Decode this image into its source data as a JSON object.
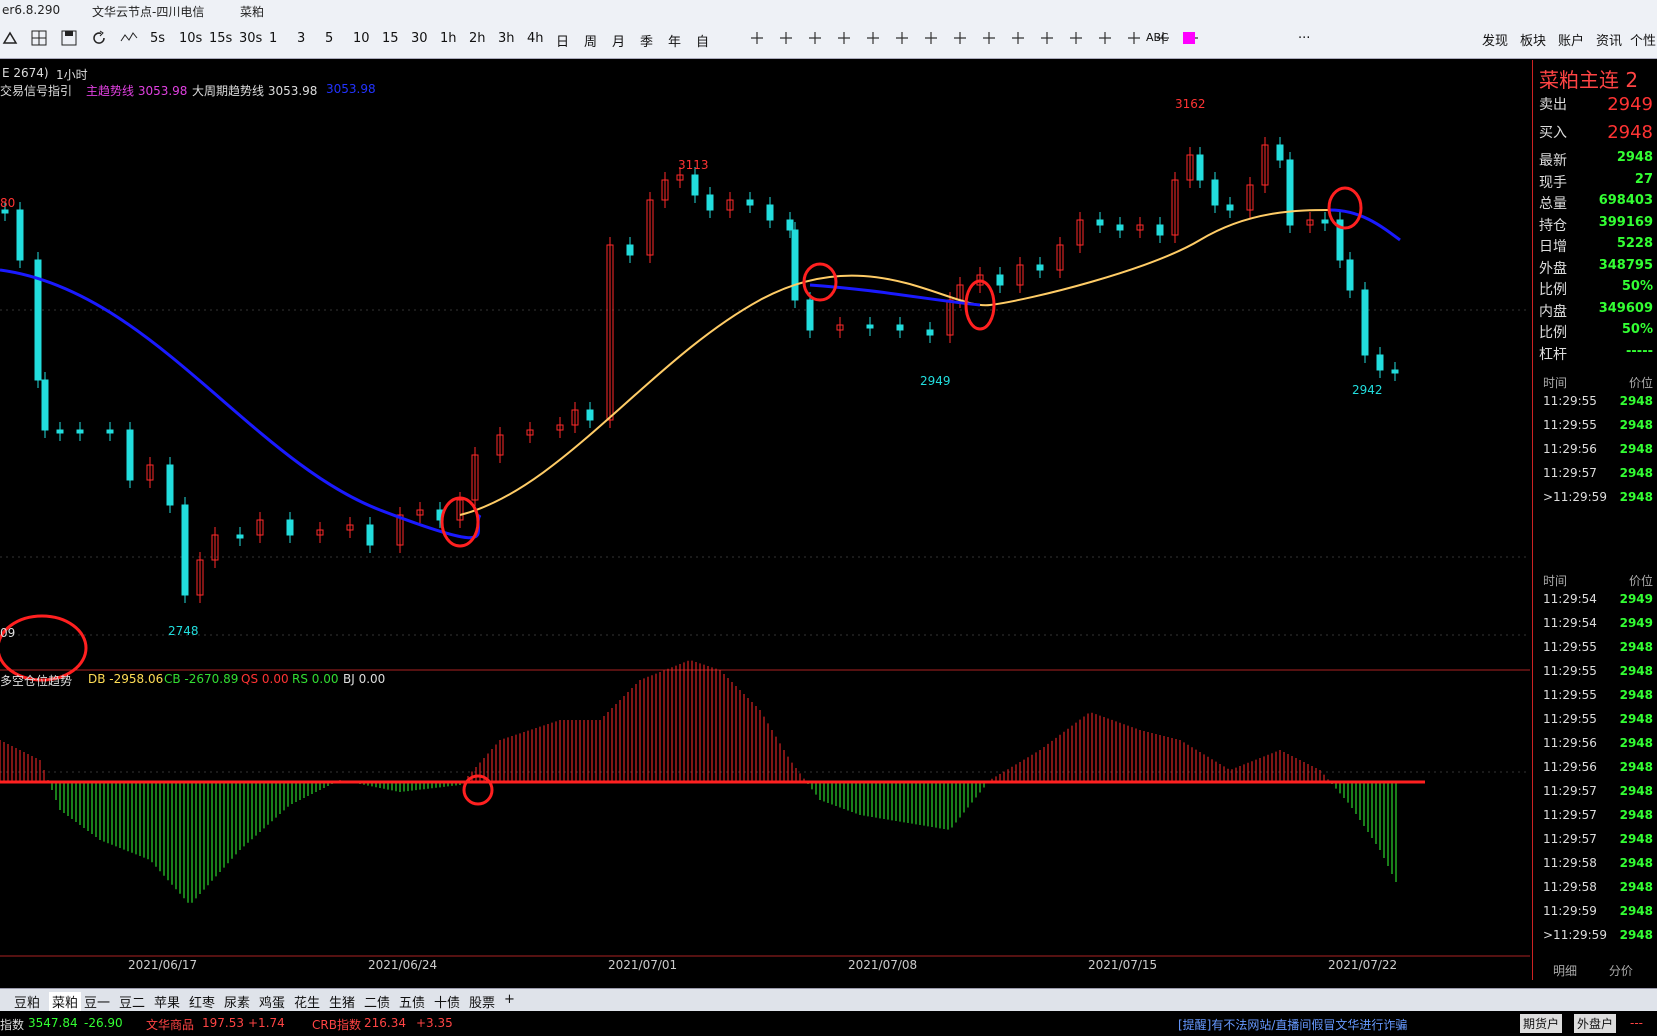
{
  "titlebar": {
    "version": "er6.8.290",
    "server": "文华云节点-四川电信",
    "symbol": "菜粕"
  },
  "toolbar": {
    "periods": [
      "5s",
      "10s",
      "15s",
      "30s",
      "1",
      "3",
      "5",
      "10",
      "15",
      "30",
      "1h",
      "2h",
      "3h",
      "4h",
      "日",
      "周",
      "月",
      "季",
      "年",
      "自"
    ],
    "abc_label": "ABC",
    "more": "···",
    "right_menu": [
      "发现",
      "板块",
      "账户",
      "资讯",
      "个性"
    ]
  },
  "chart": {
    "contract_tag": "E 2674)",
    "period": "1小时",
    "indicator_name": "交易信号指引",
    "main_trend_label": "主趋势线 3053.98",
    "big_trend_label": "大周期趋势线 3053.98",
    "blue_value": "3053.98",
    "price_labels": {
      "high_left": "3113",
      "high_right": "3162",
      "low_mid": "2949",
      "low_left": "2748",
      "low_last": "2942",
      "left_edge_top": "80",
      "left_edge_bottom": "09"
    },
    "sub_indicator_name": "多空仓位趋势",
    "db_label": "DB -2958.06",
    "cb_label": "CB -2670.89",
    "qs_label": "QS 0.00",
    "rs_label": "RS 0.00",
    "bj_label": "BJ 0.00",
    "dates": [
      "2021/06/17",
      "2021/06/24",
      "2021/07/01",
      "2021/07/08",
      "2021/07/15",
      "2021/07/22"
    ],
    "colors": {
      "up": "#ff2a2a",
      "down": "#22dddd",
      "flat": "#ffffff",
      "trend_blue": "#1a1aff",
      "trend_yellow": "#ffcc66",
      "hist_red": "#ff2a2a",
      "hist_green": "#33ff33"
    }
  },
  "side": {
    "title": "菜粕主连 2",
    "sell_label": "卖出",
    "sell_value": "2949",
    "buy_label": "买入",
    "buy_value": "2948",
    "stats": [
      {
        "k": "最新",
        "v": "2948"
      },
      {
        "k": "现手",
        "v": "27"
      },
      {
        "k": "总量",
        "v": "698403"
      },
      {
        "k": "持仓",
        "v": "399169"
      },
      {
        "k": "日增",
        "v": "5228"
      },
      {
        "k": "外盘",
        "v": "348795"
      },
      {
        "k": "比例",
        "v": "50%"
      },
      {
        "k": "内盘",
        "v": "349609"
      },
      {
        "k": "比例",
        "v": "50%"
      },
      {
        "k": "杠杆",
        "v": "-----"
      }
    ],
    "col_time": "时间",
    "col_price": "价位",
    "ticks1": [
      {
        "t": "11:29:55",
        "p": "2948"
      },
      {
        "t": "11:29:55",
        "p": "2948"
      },
      {
        "t": "11:29:56",
        "p": "2948"
      },
      {
        "t": "11:29:57",
        "p": "2948"
      },
      {
        "t": ">11:29:59",
        "p": "2948"
      }
    ],
    "ticks2": [
      {
        "t": "11:29:54",
        "p": "2949"
      },
      {
        "t": "11:29:54",
        "p": "2949"
      },
      {
        "t": "11:29:55",
        "p": "2948"
      },
      {
        "t": "11:29:55",
        "p": "2948"
      },
      {
        "t": "11:29:55",
        "p": "2948"
      },
      {
        "t": "11:29:55",
        "p": "2948"
      },
      {
        "t": "11:29:56",
        "p": "2948"
      },
      {
        "t": "11:29:56",
        "p": "2948"
      },
      {
        "t": "11:29:57",
        "p": "2948"
      },
      {
        "t": "11:29:57",
        "p": "2948"
      },
      {
        "t": "11:29:57",
        "p": "2948"
      },
      {
        "t": "11:29:58",
        "p": "2948"
      },
      {
        "t": "11:29:58",
        "p": "2948"
      },
      {
        "t": "11:29:59",
        "p": "2948"
      },
      {
        "t": ">11:29:59",
        "p": "2948"
      }
    ],
    "tab_detail": "明细",
    "tab_split": "分价"
  },
  "bottom_tabs": [
    "豆粕",
    "菜粕",
    "豆一",
    "豆二",
    "苹果",
    "红枣",
    "尿素",
    "鸡蛋",
    "花生",
    "生猪",
    "二债",
    "五债",
    "十债",
    "股票",
    "+"
  ],
  "status": {
    "idx1_label": "指数",
    "idx1_val": "3547.84",
    "idx1_chg": "-26.90",
    "idx2_label": "文华商品",
    "idx2_val": "197.53",
    "idx2_chg": "+1.74",
    "idx3_label": "CRB指数",
    "idx3_val": "216.34",
    "idx3_chg": "+3.35",
    "notice": "[提醒]有不法网站/直播间假冒文华进行诈骗",
    "btn_futures": "期货户",
    "btn_ext": "外盘户",
    "dash": "---"
  }
}
